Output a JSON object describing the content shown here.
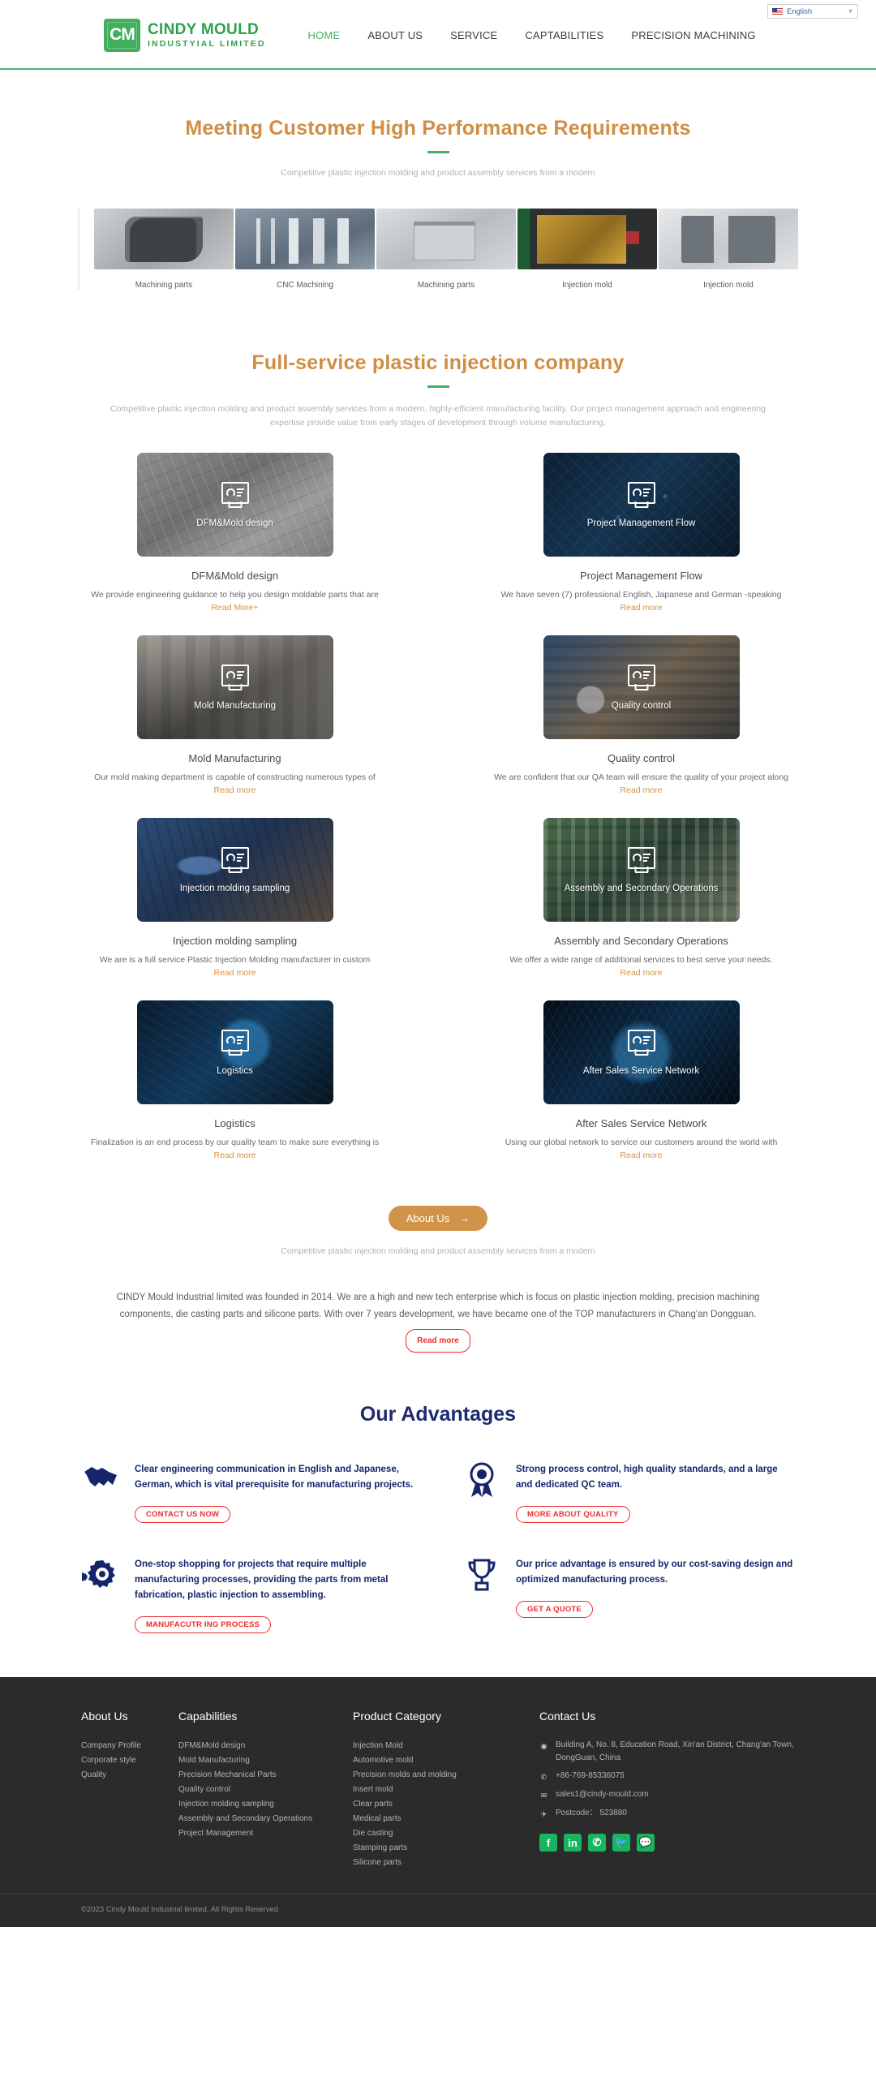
{
  "header": {
    "logo": {
      "mark": "CM",
      "line1": "CINDY MOULD",
      "line2": "INDUSTYIAL LIMITED"
    },
    "nav": [
      {
        "label": "HOME",
        "active": true
      },
      {
        "label": "ABOUT US",
        "active": false
      },
      {
        "label": "SERVICE",
        "active": false
      },
      {
        "label": "CAPTABILITIES",
        "active": false
      },
      {
        "label": "PRECISION MACHINING",
        "active": false
      }
    ],
    "language": {
      "value": "English",
      "caret": "▼"
    }
  },
  "hero": {
    "title": "Meeting Customer High Performance Requirements",
    "subtitle": "Competitive plastic injection molding and product assembly services from a modern",
    "thumbs": [
      {
        "caption": "Machining parts"
      },
      {
        "caption": "CNC Machining"
      },
      {
        "caption": "Machining parts"
      },
      {
        "caption": "Injection mold"
      },
      {
        "caption": "Injection mold"
      }
    ]
  },
  "fullservice": {
    "title": "Full-service plastic injection company",
    "subtitle": "Competitive plastic injection molding and product assembly services from a modern, highly-efficient manufacturing facility. Our project management approach and engineering expertise provide value from early stages of development through volume manufacturing.",
    "cards": [
      {
        "media_label": "DFM&Mold design",
        "title": "DFM&Mold design",
        "desc": "We provide engineering guidance to help you design moldable parts that are",
        "link": "Read More+"
      },
      {
        "media_label": "Project Management Flow",
        "title": "Project Management Flow",
        "desc": "We have seven (7) professional English, Japanese and German -speaking",
        "link": "Read more"
      },
      {
        "media_label": "Mold Manufacturing",
        "title": "Mold Manufacturing",
        "desc": "Our mold making department is capable of constructing numerous types of",
        "link": "Read more"
      },
      {
        "media_label": "Quality control",
        "title": "Quality control",
        "desc": "We are confident that our QA team will ensure the quality of your project along",
        "link": "Read more"
      },
      {
        "media_label": "Injection molding sampling",
        "title": "Injection molding sampling",
        "desc": "We are is a full service Plastic Injection Molding manufacturer in custom",
        "link": "Read more"
      },
      {
        "media_label": "Assembly and Secondary Operations",
        "title": "Assembly and Secondary Operations",
        "desc": "We offer a wide range of additional services to best serve your needs.",
        "link": "Read more"
      },
      {
        "media_label": "Logistics",
        "title": "Logistics",
        "desc": "Finalization is an end process by our quality team to make sure everything is",
        "link": "Read more"
      },
      {
        "media_label": "After Sales Service Network",
        "title": "After Sales Service Network",
        "desc": "Using our global network to service our customers around the world with",
        "link": "Read more"
      }
    ]
  },
  "about": {
    "button": "About Us",
    "button_arrow": "→",
    "subtitle": "Competitive plastic injection molding and product assembly services from a modern",
    "paragraph": "CINDY Mould Industrial limited was founded in 2014. We are a high and new tech enterprise which is focus on plastic injection molding, precision machining components, die casting parts and silicone parts. With over 7 years development, we have became one of the TOP manufacturers in Chang'an Dongguan.",
    "read_more": "Read more"
  },
  "advantages": {
    "title": "Our Advantages",
    "items": [
      {
        "icon": "handshake-icon",
        "text": "Clear engineering communication in English and Japanese, German, which is vital prerequisite for manufacturing projects.",
        "button": "CONTACT US NOW"
      },
      {
        "icon": "award-ribbon-icon",
        "text": "Strong process control, high quality standards, and a large and dedicated QC team.",
        "button": "MORE ABOUT QUALITY"
      },
      {
        "icon": "gears-icon",
        "text": "One-stop shopping for projects that require multiple manufacturing processes, providing the parts from metal fabrication, plastic injection to assembling.",
        "button": "MANUFACUTR ING PROCESS"
      },
      {
        "icon": "trophy-icon",
        "text": "Our price advantage is ensured by our cost-saving design and optimized manufacturing process.",
        "button": "GET A QUOTE"
      }
    ]
  },
  "footer": {
    "columns": [
      {
        "heading": "About Us",
        "links": [
          "Company Profile",
          "Corporate style",
          "Quality"
        ]
      },
      {
        "heading": "Capabilities",
        "links": [
          "DFM&Mold design",
          "Mold Manufacturing",
          "Precision Mechanical Parts",
          "Quality control",
          "Injection molding sampling",
          "Assembly and Secondary Operations",
          "Project Management"
        ]
      },
      {
        "heading": "Product Category",
        "links": [
          "Injection Mold",
          "Automotive mold",
          "Precision molds and molding",
          "Insert mold",
          "Clear parts",
          "Medical parts",
          "Die casting",
          "Stamping parts",
          "Silicone parts"
        ]
      }
    ],
    "contact": {
      "heading": "Contact Us",
      "address": "Building A, No. 8, Education Road, Xin'an District, Chang'an Town, DongGuan, China",
      "phone": "+86-769-85336075",
      "email": "sales1@cindy-mould.com",
      "postcode": "Postcode： 523880",
      "socials": [
        "facebook-icon",
        "linkedin-icon",
        "whatsapp-icon",
        "twitter-icon",
        "wechat-icon"
      ]
    },
    "copyright": "©2023 Cindy Mould Industrial limited. All Rights Reserved"
  },
  "colors": {
    "brand_green": "#41b05e",
    "accent_orange": "#cf8e44",
    "navy": "#16246b",
    "red": "#f12b2b"
  }
}
